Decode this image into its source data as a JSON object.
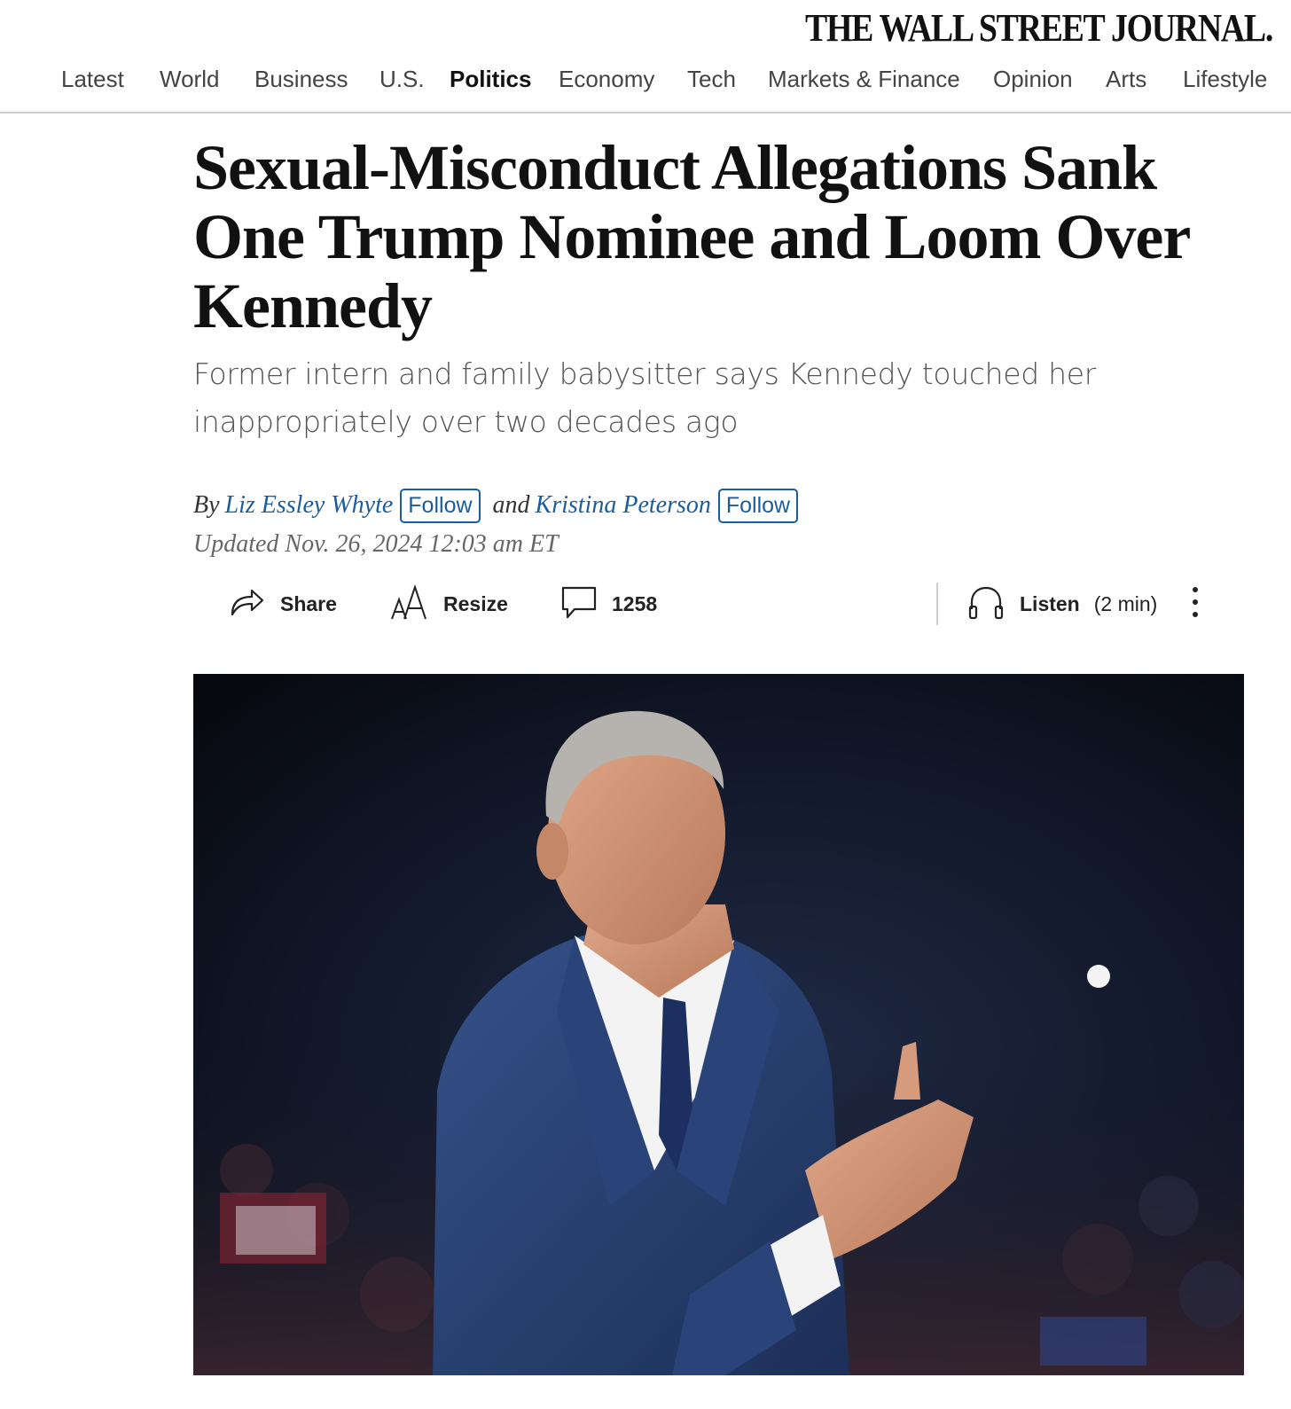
{
  "masthead": {
    "logo": "THE WALL STREET JOURNAL."
  },
  "nav": {
    "items": [
      {
        "label": "Latest",
        "active": false
      },
      {
        "label": "World",
        "active": false
      },
      {
        "label": "Business",
        "active": false
      },
      {
        "label": "U.S.",
        "active": false
      },
      {
        "label": "Politics",
        "active": true
      },
      {
        "label": "Economy",
        "active": false
      },
      {
        "label": "Tech",
        "active": false
      },
      {
        "label": "Markets & Finance",
        "active": false
      },
      {
        "label": "Opinion",
        "active": false
      },
      {
        "label": "Arts",
        "active": false
      },
      {
        "label": "Lifestyle",
        "active": false
      }
    ]
  },
  "article": {
    "headline": "Sexual-Misconduct Allegations Sank One Trump Nominee and Loom Over Kennedy",
    "dek": "Former intern and family babysitter says Kennedy touched her inappropriately over two decades ago",
    "byline": {
      "by": "By",
      "author1": "Liz Essley Whyte",
      "follow1": "Follow",
      "and": "and",
      "author2": "Kristina Peterson",
      "follow2": "Follow"
    },
    "updated": "Updated Nov. 26, 2024 12:03 am ET"
  },
  "toolbar": {
    "share_label": "Share",
    "resize_label": "Resize",
    "comments_count": "1258",
    "listen_label": "Listen",
    "listen_duration": "(2 min)",
    "share_icon": "share-arrow-icon",
    "resize_icon": "text-resize-icon",
    "comments_icon": "speech-bubble-icon",
    "listen_icon": "headphones-icon",
    "more_icon": "vertical-ellipsis-icon"
  },
  "colors": {
    "link": "#1a5d9e",
    "text": "#111111",
    "muted": "#666666",
    "photo_background": "#0c0f1a",
    "suit": "#27406e"
  }
}
